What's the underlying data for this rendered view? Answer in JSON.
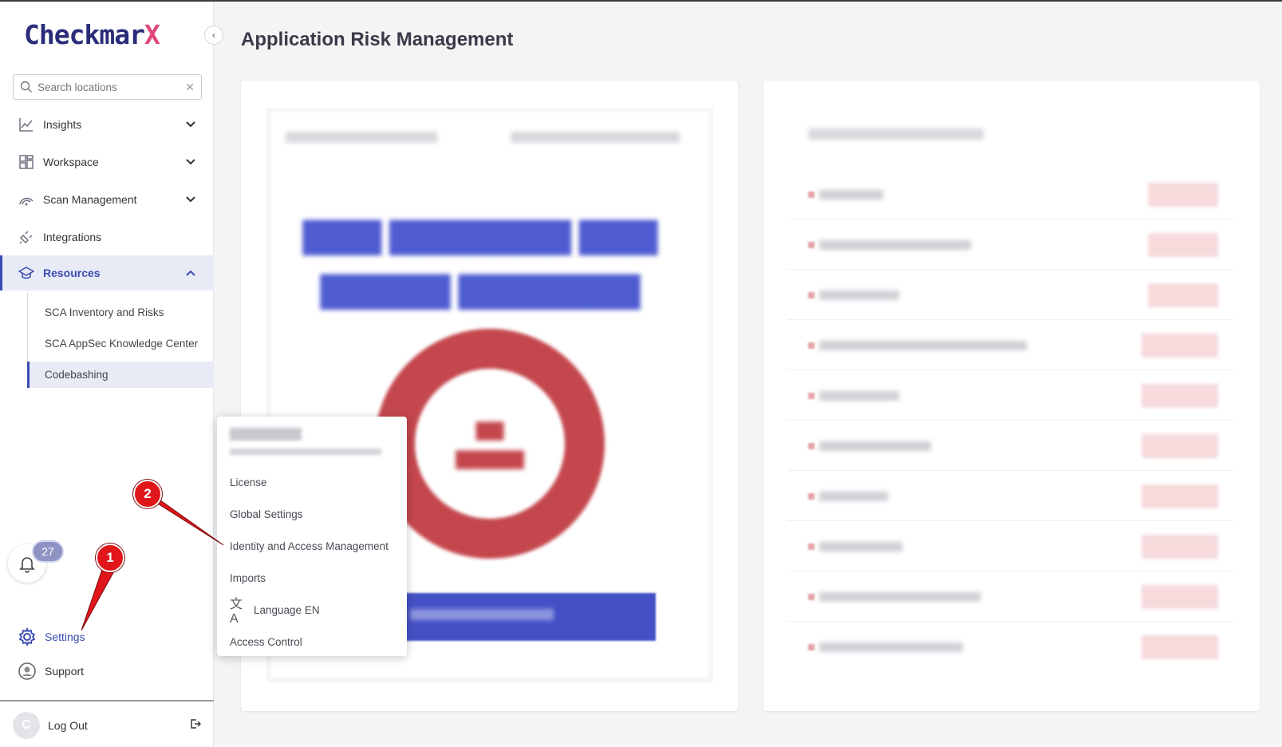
{
  "sidebar": {
    "logo_main": "Checkmar",
    "logo_accent": "X",
    "search_placeholder": "Search locations",
    "nav": [
      {
        "label": "Insights",
        "icon": "chart-line-icon"
      },
      {
        "label": "Workspace",
        "icon": "grid-icon"
      },
      {
        "label": "Scan Management",
        "icon": "radar-icon"
      },
      {
        "label": "Integrations",
        "icon": "plug-icon"
      },
      {
        "label": "Resources",
        "icon": "graduation-cap-icon"
      }
    ],
    "resources_sub": [
      "SCA Inventory and Risks",
      "SCA AppSec Knowledge Center",
      "Codebashing"
    ],
    "notifications_count": "27",
    "settings_label": "Settings",
    "support_label": "Support",
    "logout_label": "Log Out",
    "avatar_initial": "C"
  },
  "main": {
    "title": "Application Risk Management"
  },
  "settings_menu": {
    "items": [
      "License",
      "Global Settings",
      "Identity and Access Management",
      "Imports",
      "Language EN",
      "Access Control"
    ]
  },
  "annotations": {
    "callout_1": "1",
    "callout_2": "2",
    "color": "#e0161a"
  },
  "colors": {
    "accent": "#3b4bb1",
    "critical": "#c4474d",
    "brand_x": "#e0457b"
  }
}
